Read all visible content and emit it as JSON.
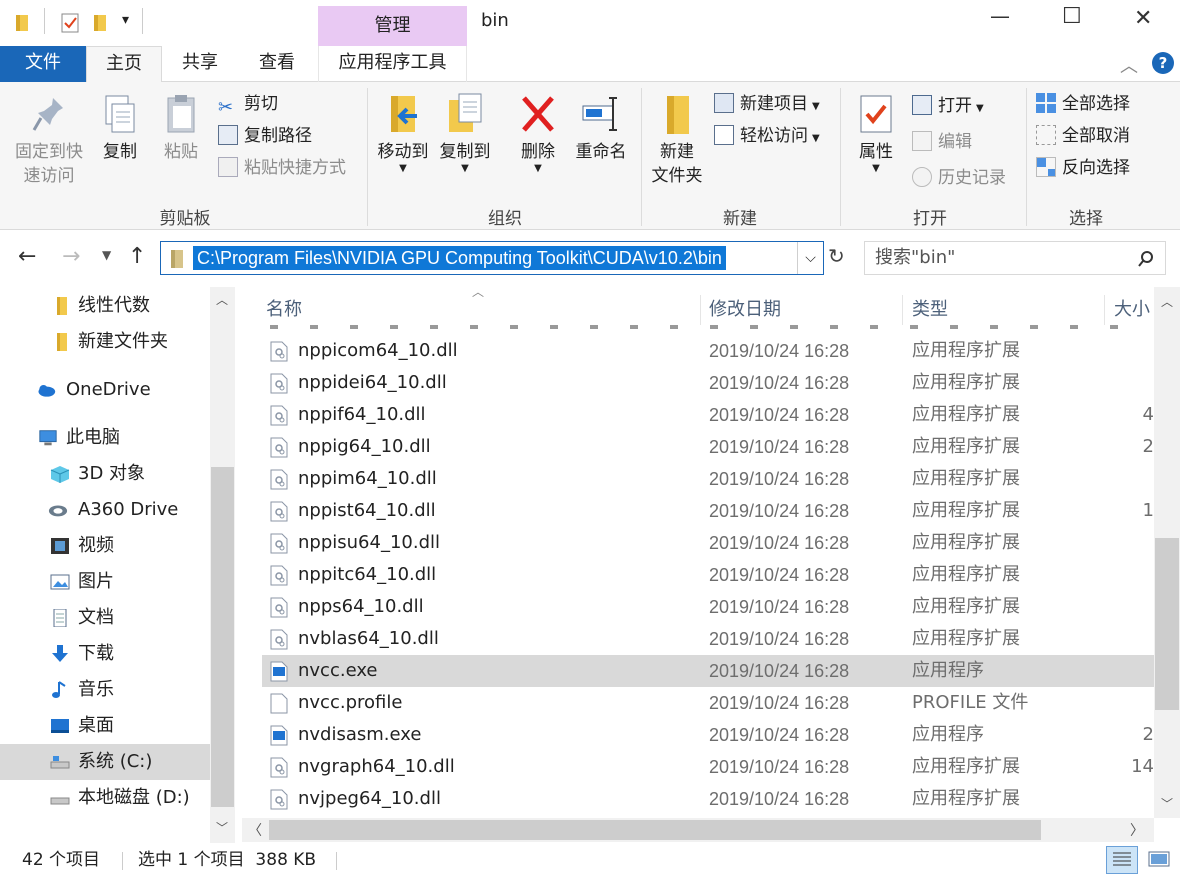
{
  "window": {
    "title": "bin",
    "context_tab": "管理",
    "min": "—",
    "max": "☐",
    "close": "✕"
  },
  "tabs": {
    "file": "文件",
    "home": "主页",
    "share": "共享",
    "view": "查看",
    "app_tools": "应用程序工具"
  },
  "ribbon": {
    "clipboard": {
      "label": "剪贴板",
      "pin_line1": "固定到快",
      "pin_line2": "速访问",
      "copy": "复制",
      "paste": "粘贴",
      "cut": "剪切",
      "copy_path": "复制路径",
      "paste_shortcut": "粘贴快捷方式"
    },
    "organize": {
      "label": "组织",
      "move_to": "移动到",
      "copy_to": "复制到",
      "delete": "删除",
      "rename": "重命名"
    },
    "new": {
      "label": "新建",
      "new_folder_line1": "新建",
      "new_folder_line2": "文件夹",
      "new_item": "新建项目",
      "easy_access": "轻松访问"
    },
    "open": {
      "label": "打开",
      "properties": "属性",
      "open": "打开",
      "edit": "编辑",
      "history": "历史记录"
    },
    "select": {
      "label": "选择",
      "select_all": "全部选择",
      "select_none": "全部取消",
      "invert": "反向选择"
    }
  },
  "address": {
    "path": "C:\\Program Files\\NVIDIA GPU Computing Toolkit\\CUDA\\v10.2\\bin",
    "search_placeholder": "搜索\"bin\""
  },
  "nav": {
    "items": [
      {
        "label": "线性代数"
      },
      {
        "label": "新建文件夹"
      },
      {
        "label": "OneDrive"
      },
      {
        "label": "此电脑"
      },
      {
        "label": "3D 对象"
      },
      {
        "label": "A360 Drive"
      },
      {
        "label": "视频"
      },
      {
        "label": "图片"
      },
      {
        "label": "文档"
      },
      {
        "label": "下载"
      },
      {
        "label": "音乐"
      },
      {
        "label": "桌面"
      },
      {
        "label": "系统 (C:)"
      },
      {
        "label": "本地磁盘 (D:)"
      }
    ]
  },
  "columns": {
    "name": "名称",
    "date": "修改日期",
    "type": "类型",
    "size": "大小"
  },
  "files": [
    {
      "name": "nppicom64_10.dll",
      "date": "2019/10/24 16:28",
      "type": "应用程序扩展",
      "size": ""
    },
    {
      "name": "nppidei64_10.dll",
      "date": "2019/10/24 16:28",
      "type": "应用程序扩展",
      "size": ""
    },
    {
      "name": "nppif64_10.dll",
      "date": "2019/10/24 16:28",
      "type": "应用程序扩展",
      "size": "4"
    },
    {
      "name": "nppig64_10.dll",
      "date": "2019/10/24 16:28",
      "type": "应用程序扩展",
      "size": "2"
    },
    {
      "name": "nppim64_10.dll",
      "date": "2019/10/24 16:28",
      "type": "应用程序扩展",
      "size": ""
    },
    {
      "name": "nppist64_10.dll",
      "date": "2019/10/24 16:28",
      "type": "应用程序扩展",
      "size": "1"
    },
    {
      "name": "nppisu64_10.dll",
      "date": "2019/10/24 16:28",
      "type": "应用程序扩展",
      "size": ""
    },
    {
      "name": "nppitc64_10.dll",
      "date": "2019/10/24 16:28",
      "type": "应用程序扩展",
      "size": ""
    },
    {
      "name": "npps64_10.dll",
      "date": "2019/10/24 16:28",
      "type": "应用程序扩展",
      "size": ""
    },
    {
      "name": "nvblas64_10.dll",
      "date": "2019/10/24 16:28",
      "type": "应用程序扩展",
      "size": ""
    },
    {
      "name": "nvcc.exe",
      "date": "2019/10/24 16:28",
      "type": "应用程序",
      "size": ""
    },
    {
      "name": "nvcc.profile",
      "date": "2019/10/24 16:28",
      "type": "PROFILE 文件",
      "size": ""
    },
    {
      "name": "nvdisasm.exe",
      "date": "2019/10/24 16:28",
      "type": "应用程序",
      "size": "2"
    },
    {
      "name": "nvgraph64_10.dll",
      "date": "2019/10/24 16:28",
      "type": "应用程序扩展",
      "size": "14"
    },
    {
      "name": "nvjpeg64_10.dll",
      "date": "2019/10/24 16:28",
      "type": "应用程序扩展",
      "size": ""
    }
  ],
  "status": {
    "count": "42 个项目",
    "selected": "选中 1 个项目  388 KB"
  },
  "colors": {
    "accent": "#1a67b8",
    "context": "#e9c9f3",
    "selection": "#d9d9d9",
    "folder": "#f2c94c"
  }
}
